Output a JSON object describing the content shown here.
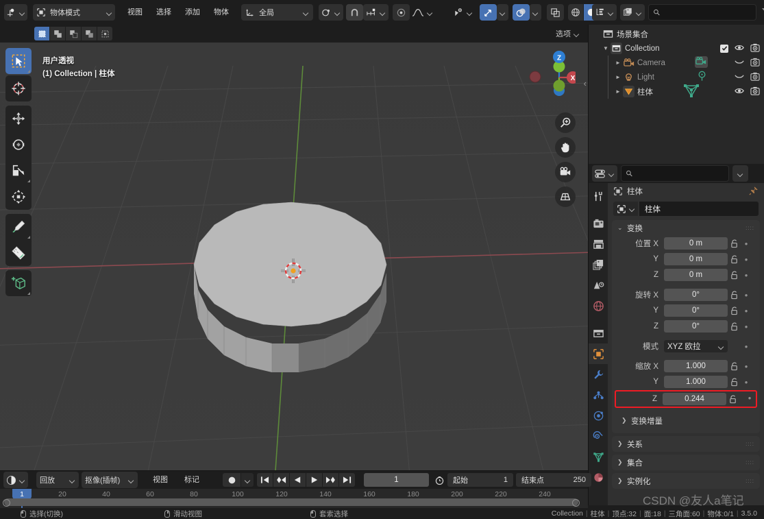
{
  "topbar": {
    "editor_type_icon": "editor-type-3d-viewport-icon",
    "mode": "物体模式",
    "menus": [
      "视图",
      "选择",
      "添加",
      "物体"
    ],
    "transform_orientation": "全局",
    "snap_icon": "magnet-icon",
    "snap_dropdown_icon": "snap-increment-icon",
    "proportional_icon": "proportional-edit-icon",
    "falloff_icon": "falloff-curve-icon",
    "visibility_icon": "object-visibility-icon",
    "gizmo_icon": "gizmo-icon",
    "overlay_icon": "overlays-icon",
    "xray_icon": "xray-toggle-icon",
    "shading_wireframe_icon": "shading-wireframe-icon",
    "shading_solid_icon": "shading-solid-icon",
    "shading_material_icon": "shading-material-icon"
  },
  "viewport": {
    "select_modes": [
      "set",
      "extend",
      "subtract",
      "invert",
      "intersect"
    ],
    "options_label": "选项",
    "overlay_line1": "用户透视",
    "overlay_line2": "(1) Collection | 柱体",
    "tools": [
      {
        "name": "tweak-select-tool",
        "icon": "cursor-select-box-icon",
        "active": true
      },
      {
        "name": "cursor-tool",
        "icon": "3d-cursor-icon",
        "active": false
      },
      {
        "name": "move-tool",
        "icon": "move-arrows-icon",
        "active": false
      },
      {
        "name": "rotate-tool",
        "icon": "rotate-icon",
        "active": false
      },
      {
        "name": "scale-tool",
        "icon": "scale-icon",
        "active": false
      },
      {
        "name": "transform-tool",
        "icon": "transform-icon",
        "active": false
      },
      {
        "name": "annotate-tool",
        "icon": "pencil-annotate-icon",
        "active": false
      },
      {
        "name": "measure-tool",
        "icon": "ruler-measure-icon",
        "active": false
      },
      {
        "name": "add-cube-tool",
        "icon": "add-cube-icon",
        "active": false
      }
    ],
    "gizmo_axes": [
      "Z",
      "X"
    ],
    "nav_buttons": [
      "zoom-icon",
      "pan-hand-icon",
      "camera-view-icon",
      "toggle-perspective-icon"
    ]
  },
  "outliner": {
    "display_mode_icon": "outliner-view-layer-icon",
    "filter_icon": "filter-funnel-icon",
    "search_placeholder": "",
    "root": "场景集合",
    "rows": [
      {
        "name": "Collection",
        "icon": "collection-icon",
        "indent": 1,
        "expanded": true,
        "checkbox": true,
        "visible_icon": "eye-icon",
        "render_icon": "camera-render-icon",
        "dim": false
      },
      {
        "name": "Camera",
        "icon": "camera-object-icon",
        "indent": 2,
        "expanded": false,
        "data_icon": "camera-data-icon",
        "visible_icon": "eye-closed-icon",
        "render_icon": "camera-render-icon",
        "dim": true
      },
      {
        "name": "Light",
        "icon": "light-object-icon",
        "indent": 2,
        "expanded": false,
        "data_icon": "light-data-icon",
        "visible_icon": "eye-closed-icon",
        "render_icon": "camera-render-icon",
        "dim": true
      },
      {
        "name": "柱体",
        "icon": "mesh-object-icon",
        "indent": 2,
        "expanded": false,
        "data_icon": "mesh-data-icon",
        "visible_icon": "eye-icon",
        "render_icon": "camera-render-icon",
        "dim": false
      }
    ]
  },
  "properties": {
    "editor_icon": "properties-editor-icon",
    "search_placeholder": "",
    "tabs": [
      {
        "name": "tool",
        "icon": "tool-screwdriver-wrench-icon",
        "selected": false
      },
      {
        "name": "render",
        "icon": "render-camera-back-icon",
        "selected": false
      },
      {
        "name": "output",
        "icon": "output-printer-icon",
        "selected": false
      },
      {
        "name": "view-layer",
        "icon": "view-layer-images-icon",
        "selected": false
      },
      {
        "name": "scene",
        "icon": "scene-cone-icon",
        "selected": false
      },
      {
        "name": "world",
        "icon": "world-globe-icon",
        "selected": false
      },
      {
        "name": "collection",
        "icon": "collection-box-icon",
        "selected": false
      },
      {
        "name": "object",
        "icon": "object-square-icon",
        "selected": true
      },
      {
        "name": "modifiers",
        "icon": "wrench-icon",
        "selected": false
      },
      {
        "name": "particles",
        "icon": "particles-icon",
        "selected": false
      },
      {
        "name": "physics",
        "icon": "physics-orbit-icon",
        "selected": false
      },
      {
        "name": "constraints",
        "icon": "constraints-clamp-icon",
        "selected": false
      },
      {
        "name": "object-data",
        "icon": "mesh-data-triangle-icon",
        "selected": false
      },
      {
        "name": "material",
        "icon": "material-sphere-icon",
        "selected": false
      }
    ],
    "breadcrumb": "柱体",
    "object_name": "柱体",
    "transform_panel": {
      "title": "变换",
      "location_label": "位置",
      "location": {
        "x": "0 m",
        "y": "0 m",
        "z": "0 m"
      },
      "rotation_label": "旋转",
      "rotation": {
        "x": "0°",
        "y": "0°",
        "z": "0°"
      },
      "mode_label": "模式",
      "mode_value": "XYZ 欧拉",
      "scale_label": "缩放",
      "scale": {
        "x": "1.000",
        "y": "1.000",
        "z": "0.244"
      },
      "axes": {
        "x": "X",
        "y": "Y",
        "z": "Z"
      },
      "delta_transform": "变换增量",
      "highlight_color": "#ee1b24"
    },
    "collapsed_panels": [
      "关系",
      "集合",
      "实例化"
    ]
  },
  "timeline": {
    "editor_icon": "timeline-editor-icon",
    "menus": [
      "回放",
      "抠像(插帧)",
      "视图",
      "标记"
    ],
    "record_icon": "record-keyframe-icon",
    "playback_buttons": [
      "jump-to-start-icon",
      "jump-prev-keyframe-icon",
      "play-reverse-icon",
      "play-icon",
      "jump-next-keyframe-icon",
      "jump-to-end-icon"
    ],
    "current_frame": "1",
    "clock_icon": "clock-icon",
    "start_label": "起始",
    "start_value": "1",
    "end_label": "结束点",
    "end_value": "250",
    "ticks": [
      20,
      40,
      60,
      80,
      100,
      120,
      140,
      160,
      180,
      200,
      220,
      240
    ],
    "playhead_frame": "1"
  },
  "statusbar": {
    "hints": [
      {
        "mouse": "left",
        "label": "选择(切换)"
      },
      {
        "mouse": "middle",
        "label": "滑动视图"
      },
      {
        "mouse": "right",
        "label": "套索选择"
      }
    ],
    "scene_stats": [
      "Collection",
      "柱体",
      "顶点:32",
      "面:18",
      "三角面:60",
      "物体:0/1",
      "3.5.0"
    ]
  },
  "watermark": "CSDN @友人a笔记",
  "colors": {
    "accent_blue": "#4772b3",
    "highlight_red": "#ee1b24",
    "axis_x": "#c4474d",
    "axis_y": "#7bbf36",
    "axis_z": "#2e7fd4",
    "object_gray": "#b4b4b4",
    "bg_dark": "#1d1d1d",
    "panel_bg": "#303030",
    "viewport_bg": "#3c3c3c"
  }
}
